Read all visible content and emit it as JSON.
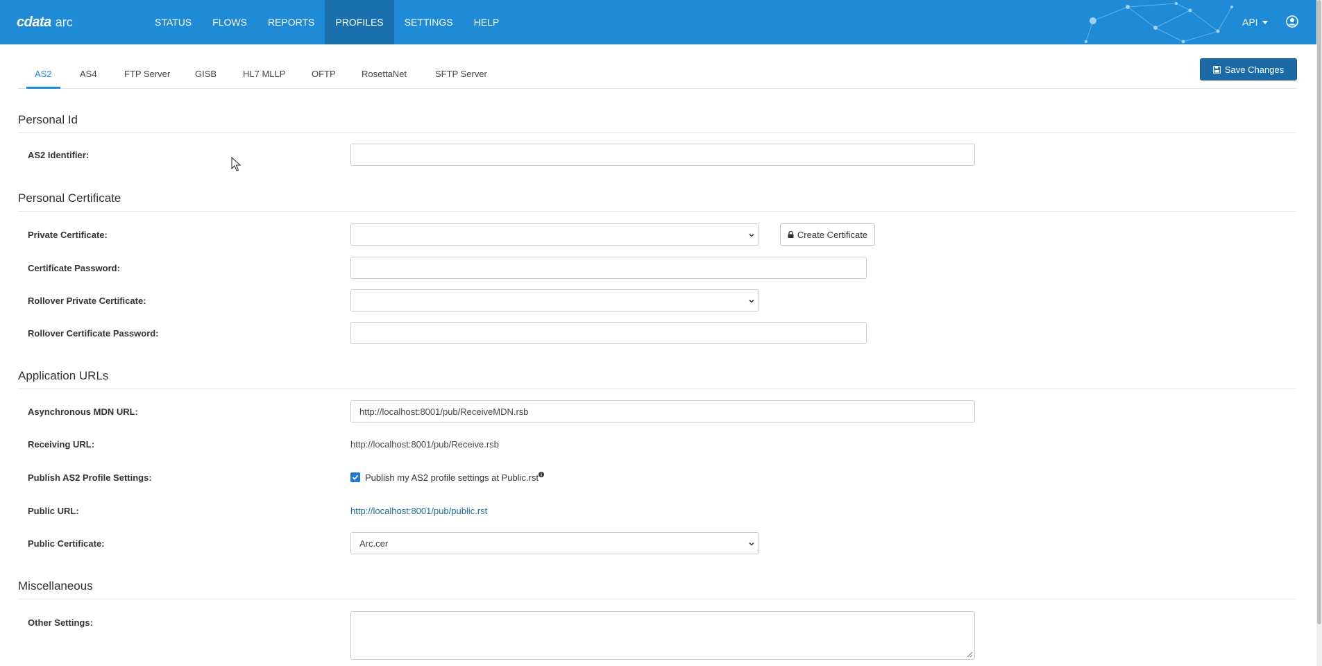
{
  "brand": {
    "name": "cdata",
    "product": "arc"
  },
  "nav": {
    "items": [
      {
        "label": "STATUS",
        "active": false
      },
      {
        "label": "FLOWS",
        "active": false
      },
      {
        "label": "REPORTS",
        "active": false
      },
      {
        "label": "PROFILES",
        "active": true
      },
      {
        "label": "SETTINGS",
        "active": false
      },
      {
        "label": "HELP",
        "active": false
      }
    ],
    "api_label": "API"
  },
  "tabs": [
    {
      "label": "AS2",
      "active": true
    },
    {
      "label": "AS4"
    },
    {
      "label": "FTP Server"
    },
    {
      "label": "GISB"
    },
    {
      "label": "HL7 MLLP"
    },
    {
      "label": "OFTP"
    },
    {
      "label": "RosettaNet"
    },
    {
      "label": "SFTP Server"
    }
  ],
  "toolbar": {
    "save_label": "Save Changes"
  },
  "sections": {
    "personal_id": {
      "title": "Personal Id",
      "as2_identifier_label": "AS2 Identifier:",
      "as2_identifier_value": ""
    },
    "personal_certificate": {
      "title": "Personal Certificate",
      "private_cert_label": "Private Certificate:",
      "private_cert_value": "",
      "create_cert_label": "Create Certificate",
      "cert_password_label": "Certificate Password:",
      "rollover_cert_label": "Rollover Private Certificate:",
      "rollover_cert_value": "",
      "rollover_password_label": "Rollover Certificate Password:"
    },
    "application_urls": {
      "title": "Application URLs",
      "async_mdn_label": "Asynchronous MDN URL:",
      "async_mdn_value": "http://localhost:8001/pub/ReceiveMDN.rsb",
      "receiving_url_label": "Receiving URL:",
      "receiving_url_value": "http://localhost:8001/pub/Receive.rsb",
      "publish_label": "Publish AS2 Profile Settings:",
      "publish_checked": true,
      "publish_checkbox_text": "Publish my AS2 profile settings at Public.rst",
      "public_url_label": "Public URL:",
      "public_url_value": "http://localhost:8001/pub/public.rst",
      "public_cert_label": "Public Certificate:",
      "public_cert_value": "Arc.cer"
    },
    "misc": {
      "title": "Miscellaneous",
      "other_settings_label": "Other Settings:",
      "other_settings_value": ""
    }
  },
  "colors": {
    "navbar": "#1f8ad6",
    "accent": "#1b6aa5",
    "active_nav": "#1a70ad"
  }
}
